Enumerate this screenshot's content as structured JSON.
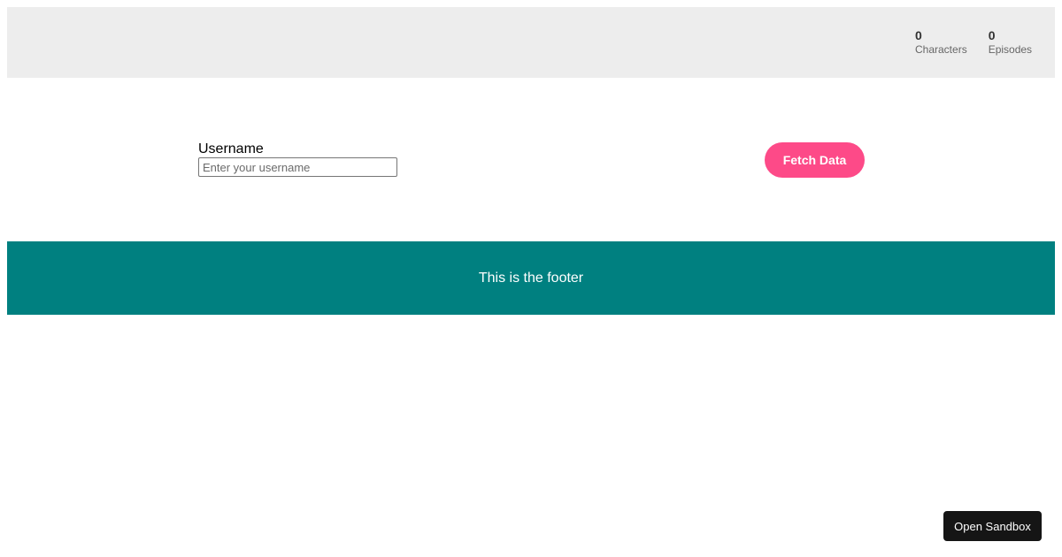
{
  "header": {
    "stats": [
      {
        "value": "0",
        "label": "Characters"
      },
      {
        "value": "0",
        "label": "Episodes"
      }
    ]
  },
  "form": {
    "username_label": "Username",
    "username_placeholder": "Enter your username",
    "username_value": "",
    "fetch_label": "Fetch Data"
  },
  "footer": {
    "text": "This is the footer"
  },
  "sandbox": {
    "label": "Open Sandbox"
  },
  "colors": {
    "header_bg": "#ededed",
    "button_accent": "#fd4a88",
    "footer_bg": "#008080",
    "sandbox_bg": "#151515"
  }
}
